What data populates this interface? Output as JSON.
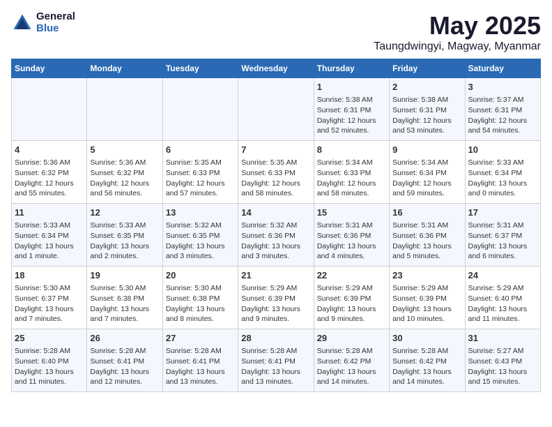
{
  "logo": {
    "general": "General",
    "blue": "Blue"
  },
  "title": "May 2025",
  "subtitle": "Taungdwingyi, Magway, Myanmar",
  "days_header": [
    "Sunday",
    "Monday",
    "Tuesday",
    "Wednesday",
    "Thursday",
    "Friday",
    "Saturday"
  ],
  "weeks": [
    [
      {
        "day": "",
        "info": ""
      },
      {
        "day": "",
        "info": ""
      },
      {
        "day": "",
        "info": ""
      },
      {
        "day": "",
        "info": ""
      },
      {
        "day": "1",
        "info": "Sunrise: 5:38 AM\nSunset: 6:31 PM\nDaylight: 12 hours\nand 52 minutes."
      },
      {
        "day": "2",
        "info": "Sunrise: 5:38 AM\nSunset: 6:31 PM\nDaylight: 12 hours\nand 53 minutes."
      },
      {
        "day": "3",
        "info": "Sunrise: 5:37 AM\nSunset: 6:31 PM\nDaylight: 12 hours\nand 54 minutes."
      }
    ],
    [
      {
        "day": "4",
        "info": "Sunrise: 5:36 AM\nSunset: 6:32 PM\nDaylight: 12 hours\nand 55 minutes."
      },
      {
        "day": "5",
        "info": "Sunrise: 5:36 AM\nSunset: 6:32 PM\nDaylight: 12 hours\nand 56 minutes."
      },
      {
        "day": "6",
        "info": "Sunrise: 5:35 AM\nSunset: 6:33 PM\nDaylight: 12 hours\nand 57 minutes."
      },
      {
        "day": "7",
        "info": "Sunrise: 5:35 AM\nSunset: 6:33 PM\nDaylight: 12 hours\nand 58 minutes."
      },
      {
        "day": "8",
        "info": "Sunrise: 5:34 AM\nSunset: 6:33 PM\nDaylight: 12 hours\nand 58 minutes."
      },
      {
        "day": "9",
        "info": "Sunrise: 5:34 AM\nSunset: 6:34 PM\nDaylight: 12 hours\nand 59 minutes."
      },
      {
        "day": "10",
        "info": "Sunrise: 5:33 AM\nSunset: 6:34 PM\nDaylight: 13 hours\nand 0 minutes."
      }
    ],
    [
      {
        "day": "11",
        "info": "Sunrise: 5:33 AM\nSunset: 6:34 PM\nDaylight: 13 hours\nand 1 minute."
      },
      {
        "day": "12",
        "info": "Sunrise: 5:33 AM\nSunset: 6:35 PM\nDaylight: 13 hours\nand 2 minutes."
      },
      {
        "day": "13",
        "info": "Sunrise: 5:32 AM\nSunset: 6:35 PM\nDaylight: 13 hours\nand 3 minutes."
      },
      {
        "day": "14",
        "info": "Sunrise: 5:32 AM\nSunset: 6:36 PM\nDaylight: 13 hours\nand 3 minutes."
      },
      {
        "day": "15",
        "info": "Sunrise: 5:31 AM\nSunset: 6:36 PM\nDaylight: 13 hours\nand 4 minutes."
      },
      {
        "day": "16",
        "info": "Sunrise: 5:31 AM\nSunset: 6:36 PM\nDaylight: 13 hours\nand 5 minutes."
      },
      {
        "day": "17",
        "info": "Sunrise: 5:31 AM\nSunset: 6:37 PM\nDaylight: 13 hours\nand 6 minutes."
      }
    ],
    [
      {
        "day": "18",
        "info": "Sunrise: 5:30 AM\nSunset: 6:37 PM\nDaylight: 13 hours\nand 7 minutes."
      },
      {
        "day": "19",
        "info": "Sunrise: 5:30 AM\nSunset: 6:38 PM\nDaylight: 13 hours\nand 7 minutes."
      },
      {
        "day": "20",
        "info": "Sunrise: 5:30 AM\nSunset: 6:38 PM\nDaylight: 13 hours\nand 8 minutes."
      },
      {
        "day": "21",
        "info": "Sunrise: 5:29 AM\nSunset: 6:39 PM\nDaylight: 13 hours\nand 9 minutes."
      },
      {
        "day": "22",
        "info": "Sunrise: 5:29 AM\nSunset: 6:39 PM\nDaylight: 13 hours\nand 9 minutes."
      },
      {
        "day": "23",
        "info": "Sunrise: 5:29 AM\nSunset: 6:39 PM\nDaylight: 13 hours\nand 10 minutes."
      },
      {
        "day": "24",
        "info": "Sunrise: 5:29 AM\nSunset: 6:40 PM\nDaylight: 13 hours\nand 11 minutes."
      }
    ],
    [
      {
        "day": "25",
        "info": "Sunrise: 5:28 AM\nSunset: 6:40 PM\nDaylight: 13 hours\nand 11 minutes."
      },
      {
        "day": "26",
        "info": "Sunrise: 5:28 AM\nSunset: 6:41 PM\nDaylight: 13 hours\nand 12 minutes."
      },
      {
        "day": "27",
        "info": "Sunrise: 5:28 AM\nSunset: 6:41 PM\nDaylight: 13 hours\nand 13 minutes."
      },
      {
        "day": "28",
        "info": "Sunrise: 5:28 AM\nSunset: 6:41 PM\nDaylight: 13 hours\nand 13 minutes."
      },
      {
        "day": "29",
        "info": "Sunrise: 5:28 AM\nSunset: 6:42 PM\nDaylight: 13 hours\nand 14 minutes."
      },
      {
        "day": "30",
        "info": "Sunrise: 5:28 AM\nSunset: 6:42 PM\nDaylight: 13 hours\nand 14 minutes."
      },
      {
        "day": "31",
        "info": "Sunrise: 5:27 AM\nSunset: 6:43 PM\nDaylight: 13 hours\nand 15 minutes."
      }
    ]
  ]
}
